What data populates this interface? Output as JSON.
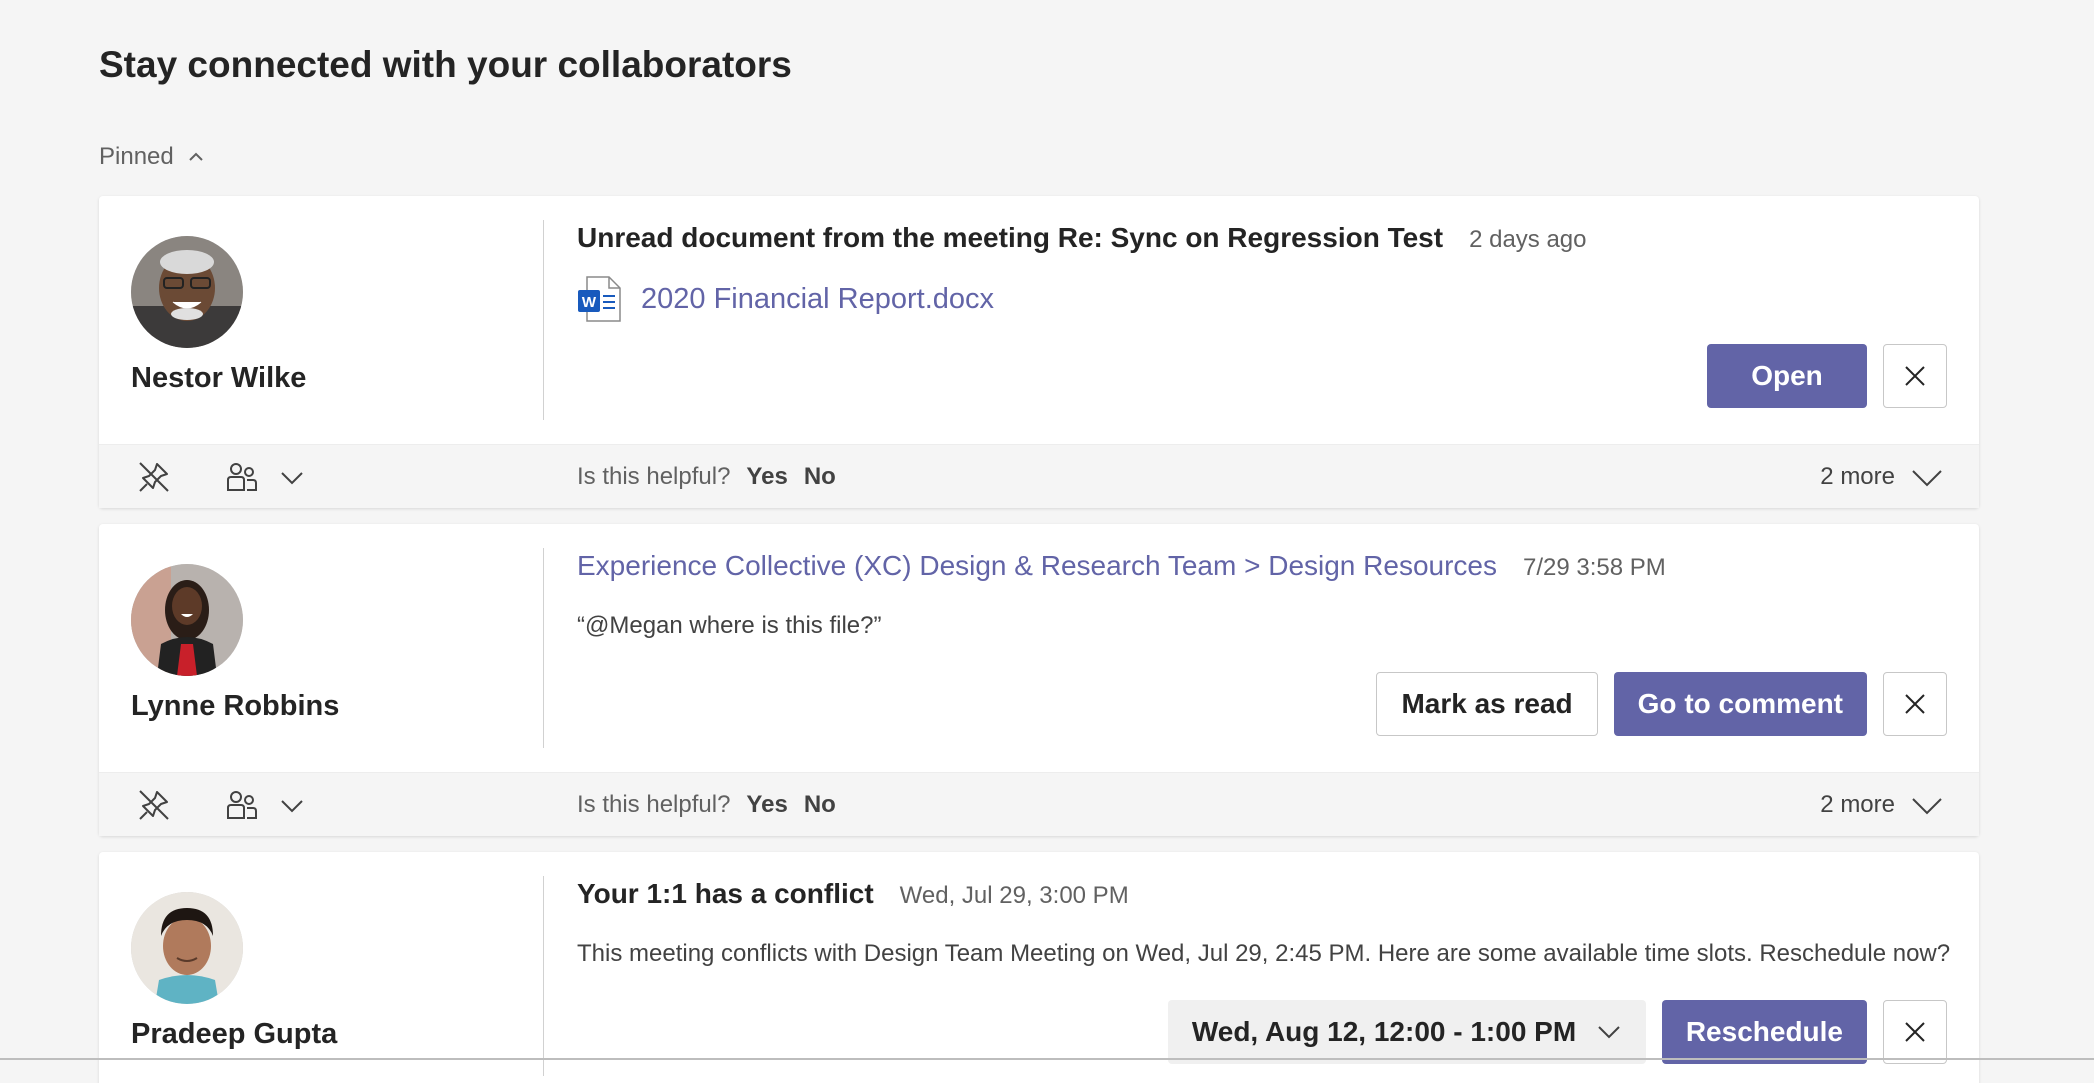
{
  "page": {
    "title": "Stay connected with your collaborators",
    "section_label": "Pinned"
  },
  "cards": [
    {
      "person": "Nestor Wilke",
      "headline": "Unread document from the meeting Re: Sync on Regression Test",
      "timestamp": "2 days ago",
      "file_name": "2020 Financial Report.docx",
      "primary_label": "Open",
      "helpful_question": "Is this helpful?",
      "yes_label": "Yes",
      "no_label": "No",
      "more_label": "2 more"
    },
    {
      "person": "Lynne Robbins",
      "headline": "Experience Collective (XC) Design & Research Team > Design Resources",
      "timestamp": "7/29 3:58 PM",
      "body": "“@Megan where is this file?”",
      "secondary_label": "Mark as read",
      "primary_label": "Go to comment",
      "helpful_question": "Is this helpful?",
      "yes_label": "Yes",
      "no_label": "No",
      "more_label": "2 more"
    },
    {
      "person": "Pradeep Gupta",
      "headline": "Your 1:1 has a conflict",
      "timestamp": "Wed, Jul 29, 3:00 PM",
      "body": "This meeting conflicts with Design Team Meeting on Wed, Jul 29, 2:45 PM. Here are some available time slots. Reschedule now?",
      "dropdown_value": "Wed, Aug 12, 12:00 - 1:00 PM",
      "primary_label": "Reschedule"
    }
  ],
  "colors": {
    "accent": "#6264a7",
    "background": "#f5f5f5",
    "card": "#ffffff"
  },
  "icons": {
    "section_toggle": "chevron-up-icon",
    "file": "word-document-icon",
    "close": "close-icon",
    "unpin": "unpin-icon",
    "people": "people-icon",
    "expand": "chevron-down-icon"
  }
}
